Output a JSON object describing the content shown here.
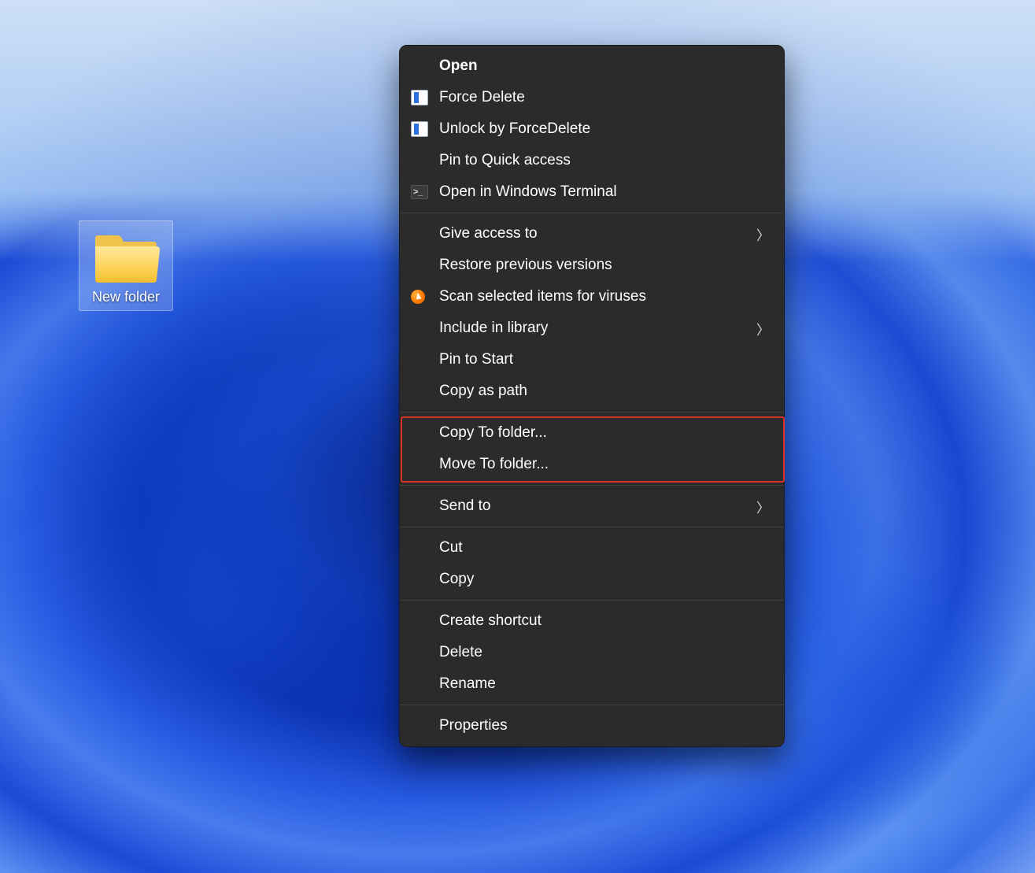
{
  "desktop": {
    "folder_label": "New folder"
  },
  "context_menu": {
    "items": [
      {
        "label": "Open",
        "bold": true,
        "icon": null,
        "submenu": false
      },
      {
        "label": "Force Delete",
        "icon": "app-icon",
        "submenu": false
      },
      {
        "label": "Unlock by ForceDelete",
        "icon": "app-icon",
        "submenu": false
      },
      {
        "label": "Pin to Quick access",
        "icon": null,
        "submenu": false
      },
      {
        "label": "Open in Windows Terminal",
        "icon": "terminal-icon",
        "submenu": false
      },
      {
        "separator": true
      },
      {
        "label": "Give access to",
        "icon": null,
        "submenu": true
      },
      {
        "label": "Restore previous versions",
        "icon": null,
        "submenu": false
      },
      {
        "label": "Scan selected items for viruses",
        "icon": "avast-icon",
        "submenu": false
      },
      {
        "label": "Include in library",
        "icon": null,
        "submenu": true
      },
      {
        "label": "Pin to Start",
        "icon": null,
        "submenu": false
      },
      {
        "label": "Copy as path",
        "icon": null,
        "submenu": false
      },
      {
        "separator": true
      },
      {
        "label": "Copy To folder...",
        "icon": null,
        "submenu": false,
        "highlighted": true
      },
      {
        "label": "Move To folder...",
        "icon": null,
        "submenu": false,
        "highlighted": true
      },
      {
        "separator": true
      },
      {
        "label": "Send to",
        "icon": null,
        "submenu": true
      },
      {
        "separator": true
      },
      {
        "label": "Cut",
        "icon": null,
        "submenu": false
      },
      {
        "label": "Copy",
        "icon": null,
        "submenu": false
      },
      {
        "separator": true
      },
      {
        "label": "Create shortcut",
        "icon": null,
        "submenu": false
      },
      {
        "label": "Delete",
        "icon": null,
        "submenu": false
      },
      {
        "label": "Rename",
        "icon": null,
        "submenu": false
      },
      {
        "separator": true
      },
      {
        "label": "Properties",
        "icon": null,
        "submenu": false
      }
    ],
    "highlight_color": "#d8322a"
  }
}
